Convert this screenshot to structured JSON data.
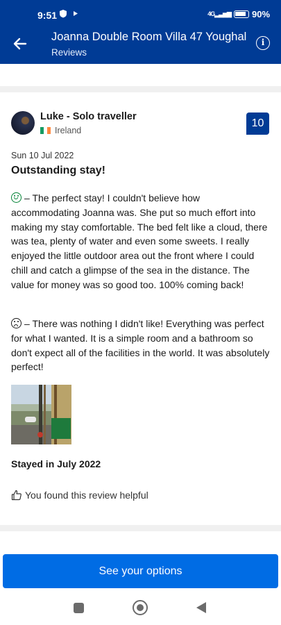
{
  "status_bar": {
    "time": "9:51",
    "network": "4G",
    "battery": "90"
  },
  "header": {
    "title": "Joanna Double Room Villa 47 Youghal",
    "subtitle": "Reviews",
    "back_icon": "arrow-left-icon",
    "info_icon": "info-icon",
    "bg_color": "#003b95"
  },
  "review": {
    "reviewer_name": "Luke - Solo traveller",
    "country": "Ireland",
    "score": "10",
    "date": "Sun 10 Jul 2022",
    "title": "Outstanding stay!",
    "positive_sep": "–",
    "positive_text": "The perfect stay! I couldn't believe how accommodating Joanna was. She put so much effort into making my stay comfortable. The bed felt like a cloud, there was tea, plenty of water and even some sweets. I really enjoyed the little outdoor area out the front where I could chill and catch a glimpse of the sea in the distance. The value for money was so good too. 100% coming back!",
    "negative_sep": "–",
    "negative_text": "There was nothing I didn't like! Everything was perfect for what I wanted. It is a simple room and a bathroom so don't expect all of the facilities in the world. It was absolutely perfect!",
    "stayed": "Stayed in July 2022",
    "helpful": "You found this review helpful"
  },
  "cta": {
    "label": "See your options",
    "color": "#006ce4"
  },
  "nav": {
    "recent_icon": "square-icon",
    "home_icon": "circle-icon",
    "back_icon": "triangle-back-icon"
  }
}
